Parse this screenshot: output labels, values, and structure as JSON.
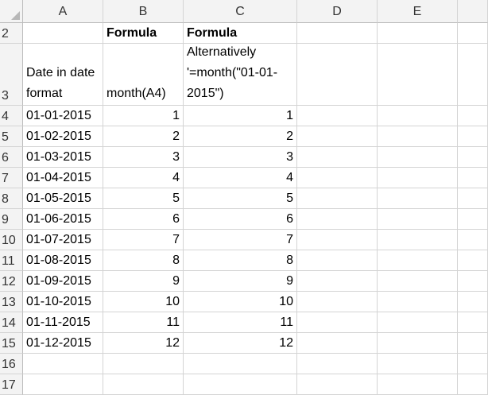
{
  "columns": [
    "A",
    "B",
    "C",
    "D",
    "E"
  ],
  "header_row": {
    "row": "2",
    "b": "Formula",
    "c": "Formula"
  },
  "label_row": {
    "row": "3",
    "a": "Date in date format",
    "b": "month(A4)",
    "c": "Alternatively '=month(\"01-01-2015\")"
  },
  "rows": [
    {
      "row": "4",
      "date": "01-01-2015",
      "b": "1",
      "c": "1"
    },
    {
      "row": "5",
      "date": "01-02-2015",
      "b": "2",
      "c": "2"
    },
    {
      "row": "6",
      "date": "01-03-2015",
      "b": "3",
      "c": "3"
    },
    {
      "row": "7",
      "date": "01-04-2015",
      "b": "4",
      "c": "4"
    },
    {
      "row": "8",
      "date": "01-05-2015",
      "b": "5",
      "c": "5"
    },
    {
      "row": "9",
      "date": "01-06-2015",
      "b": "6",
      "c": "6"
    },
    {
      "row": "10",
      "date": "01-07-2015",
      "b": "7",
      "c": "7"
    },
    {
      "row": "11",
      "date": "01-08-2015",
      "b": "8",
      "c": "8"
    },
    {
      "row": "12",
      "date": "01-09-2015",
      "b": "9",
      "c": "9"
    },
    {
      "row": "13",
      "date": "01-10-2015",
      "b": "10",
      "c": "10"
    },
    {
      "row": "14",
      "date": "01-11-2015",
      "b": "11",
      "c": "11"
    },
    {
      "row": "15",
      "date": "01-12-2015",
      "b": "12",
      "c": "12"
    }
  ],
  "empty_rows": [
    "16",
    "17"
  ]
}
